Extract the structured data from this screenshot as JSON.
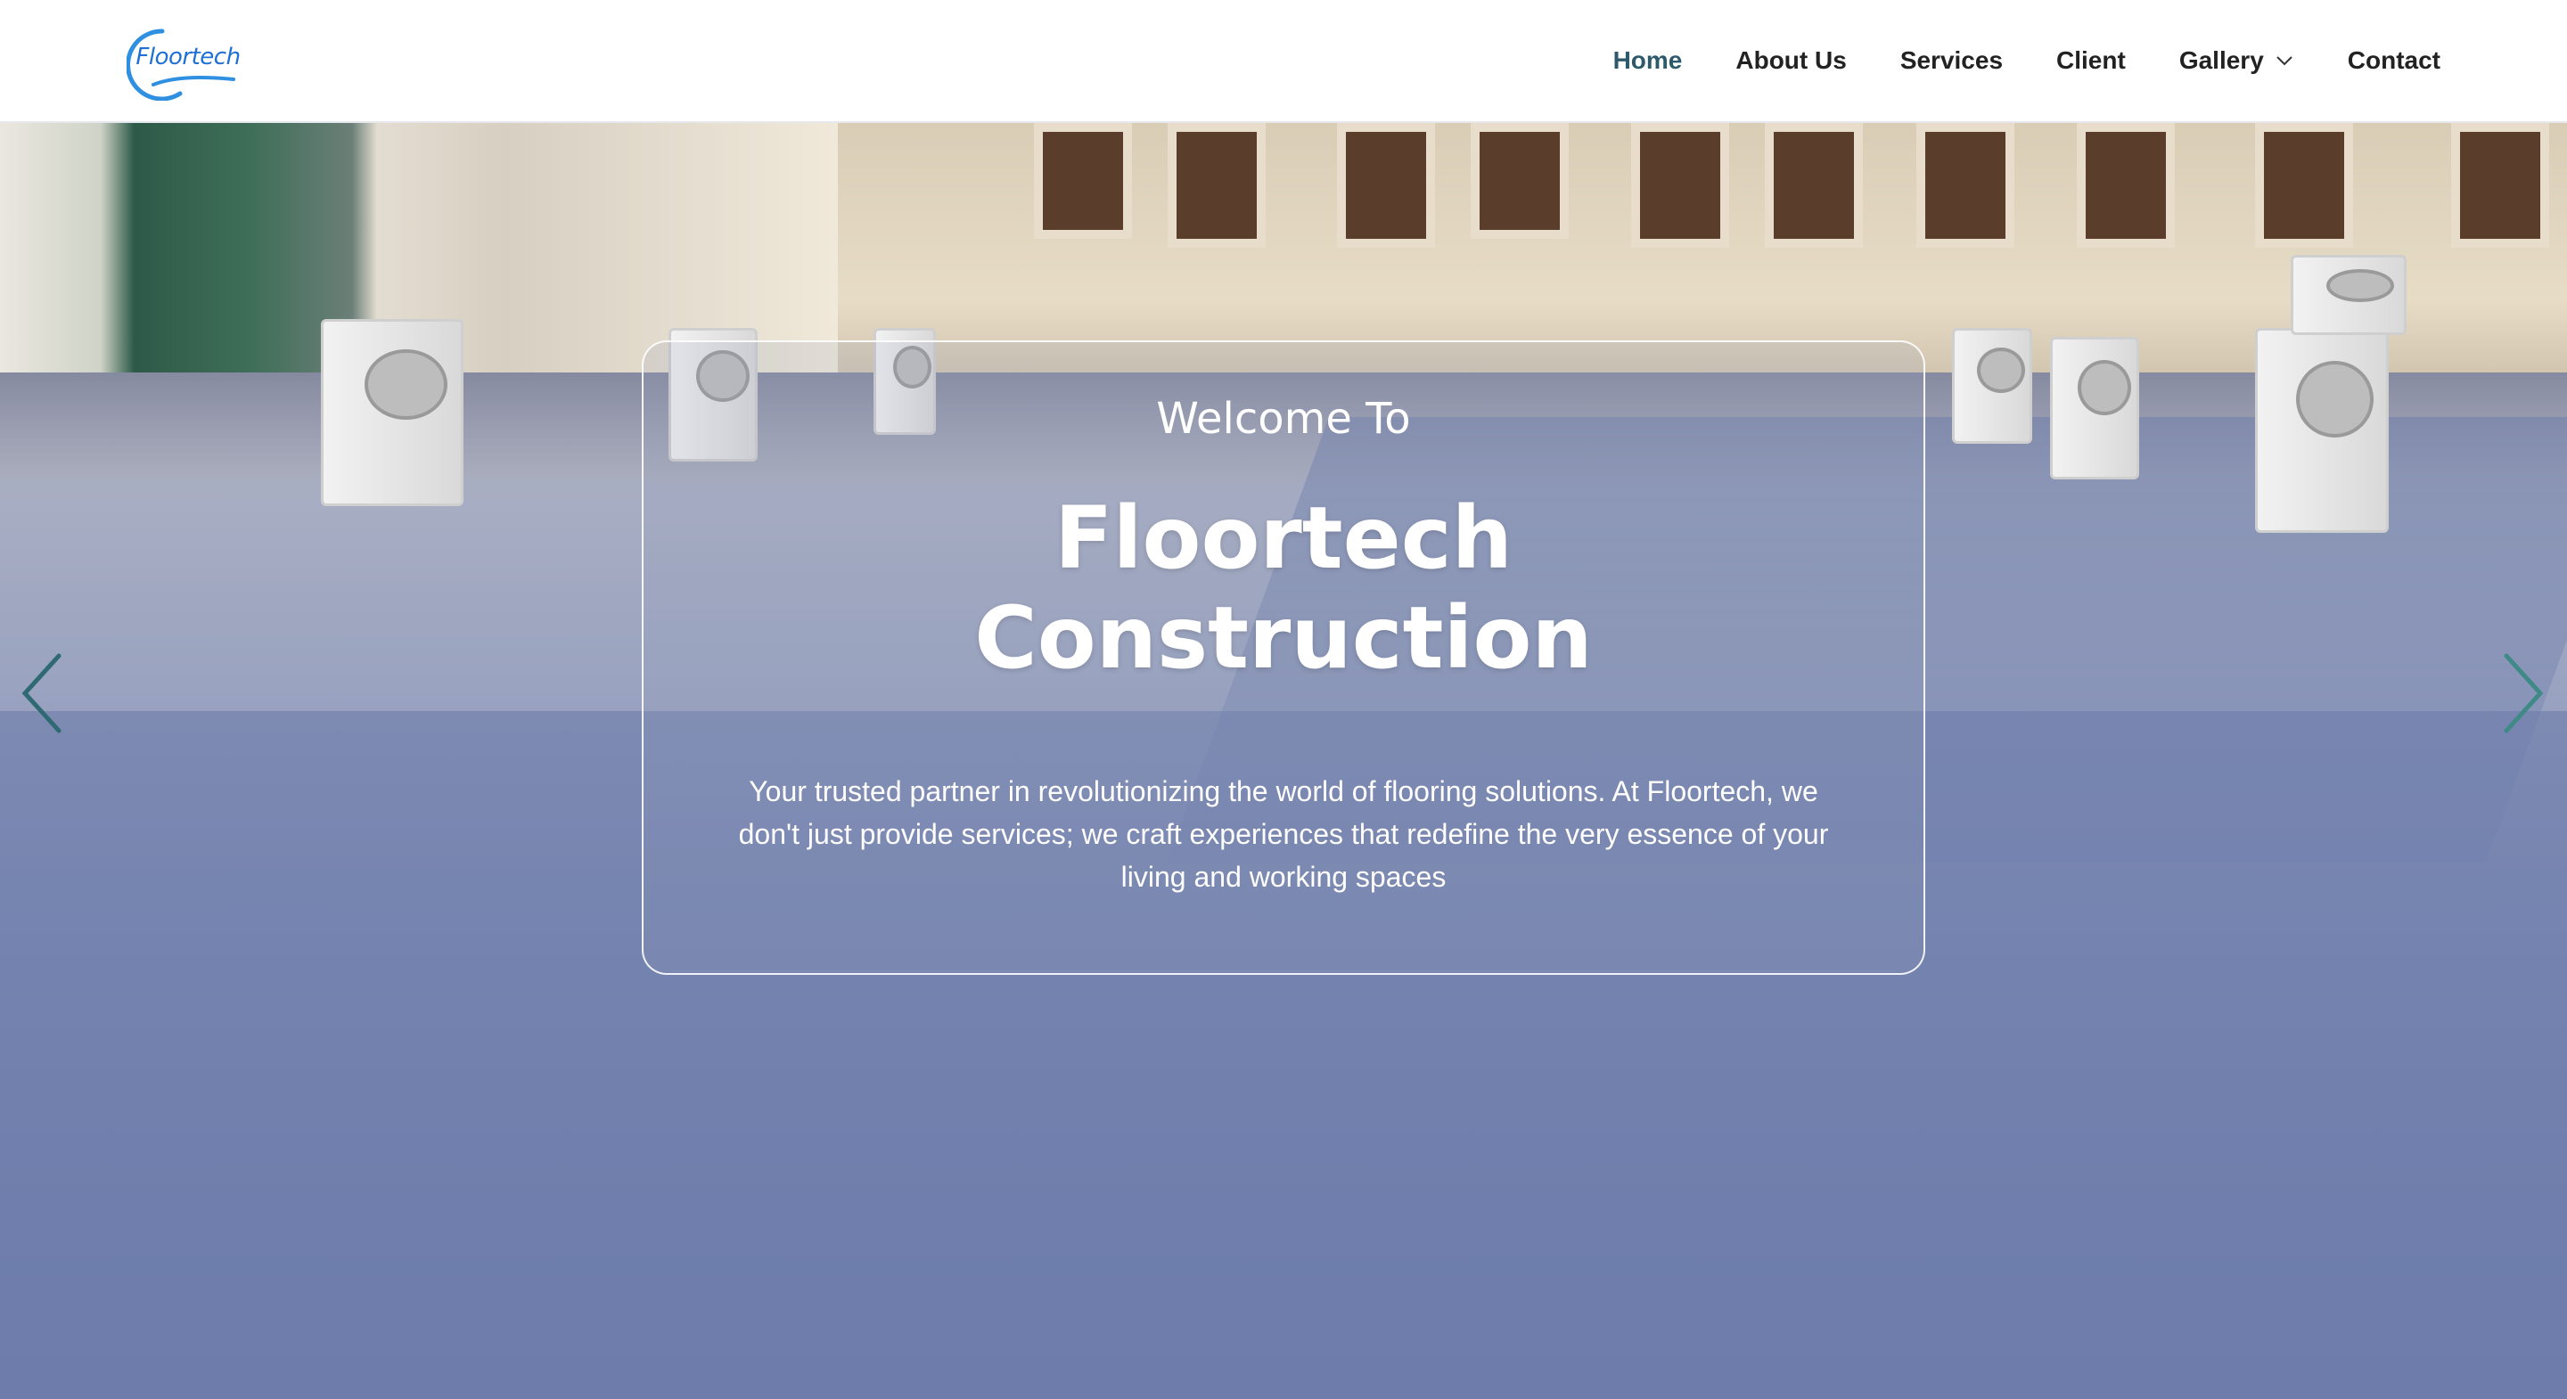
{
  "brand": {
    "logo_text": "Floortech"
  },
  "nav": {
    "items": [
      {
        "label": "Home",
        "active": true
      },
      {
        "label": "About Us"
      },
      {
        "label": "Services"
      },
      {
        "label": "Client"
      },
      {
        "label": "Gallery",
        "has_dropdown": true
      },
      {
        "label": "Contact"
      }
    ]
  },
  "hero": {
    "welcome": "Welcome To",
    "title_line1": "Floortech",
    "title_line2": "Construction",
    "description": "Your trusted partner in revolutionizing the world of flooring solutions. At Floortech, we don't just provide services; we craft experiences that redefine the very essence of your living and working spaces",
    "prev_icon": "chevron-left-icon",
    "next_icon": "chevron-right-icon"
  },
  "colors": {
    "active_nav": "#2d5a6b",
    "nav_text": "#222222",
    "logo_blue": "#1e6fd6"
  }
}
